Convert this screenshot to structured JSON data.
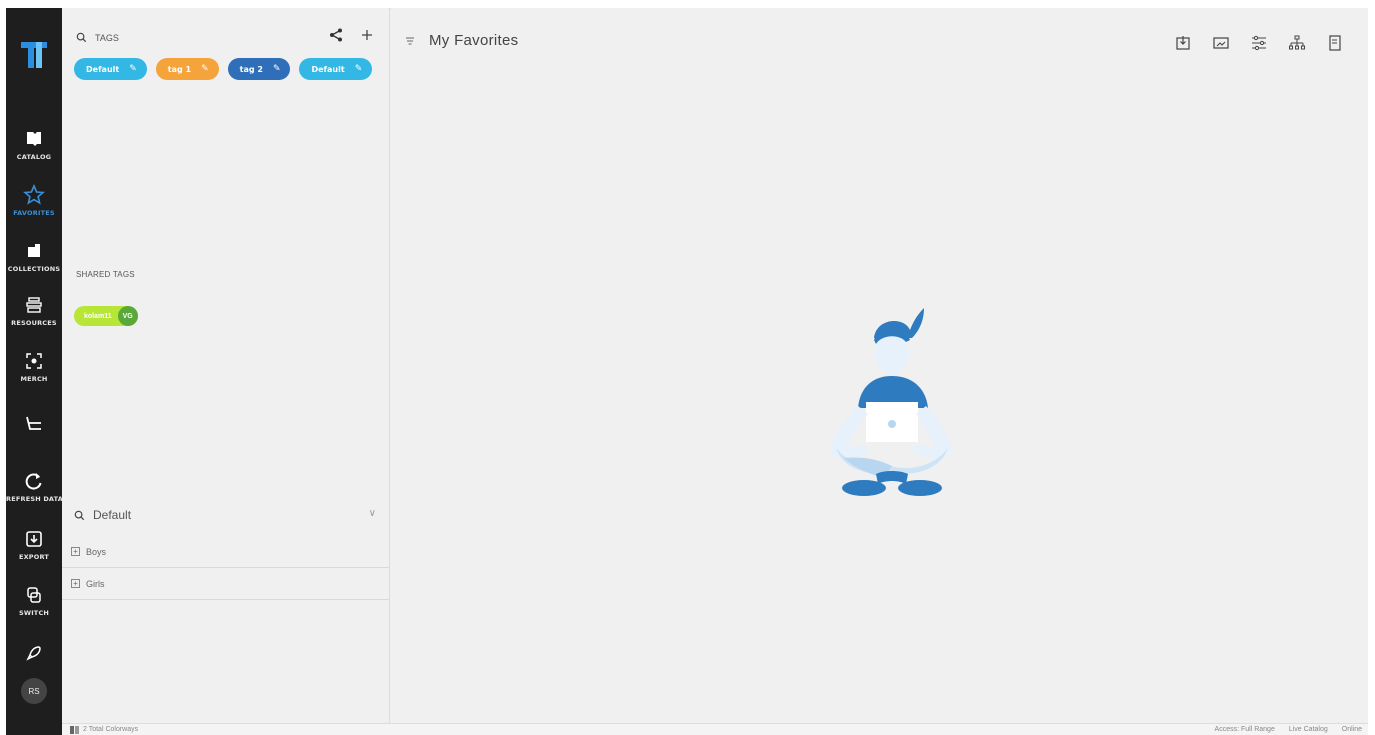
{
  "nav": {
    "items": [
      {
        "label": "CATALOG",
        "icon": "book-icon"
      },
      {
        "label": "FAVORITES",
        "icon": "star-icon"
      },
      {
        "label": "COLLECTIONS",
        "icon": "folder-icon"
      },
      {
        "label": "RESOURCES",
        "icon": "resources-icon"
      },
      {
        "label": "MERCH",
        "icon": "merch-icon"
      },
      {
        "label": "",
        "icon": "basket-icon"
      },
      {
        "label": "REFRESH DATA",
        "icon": "refresh-icon"
      },
      {
        "label": "EXPORT",
        "icon": "export-icon"
      },
      {
        "label": "SWITCH",
        "icon": "switch-icon"
      },
      {
        "label": "",
        "icon": "rocket-icon"
      }
    ],
    "avatar": "RS",
    "active_color": "#3a8fd9"
  },
  "tags_panel": {
    "title": "TAGS",
    "tags": [
      {
        "label": "Default",
        "color": "#33b8e6"
      },
      {
        "label": "tag 1",
        "color": "#f5a33b"
      },
      {
        "label": "tag 2",
        "color": "#2f6fba"
      },
      {
        "label": "Default",
        "color": "#33b8e6"
      }
    ],
    "shared_title": "SHARED TAGS",
    "shared_tag": {
      "label": "kolam11",
      "badge": "VG",
      "color": "#b8e636"
    },
    "filter": {
      "value": "Default"
    },
    "tree": [
      "Boys",
      "Girls"
    ]
  },
  "main": {
    "title": "My Favorites"
  },
  "status": {
    "total": "2 Total Colorways",
    "access": "Access: Full Range",
    "catalog": "Live Catalog",
    "online": "Online"
  }
}
